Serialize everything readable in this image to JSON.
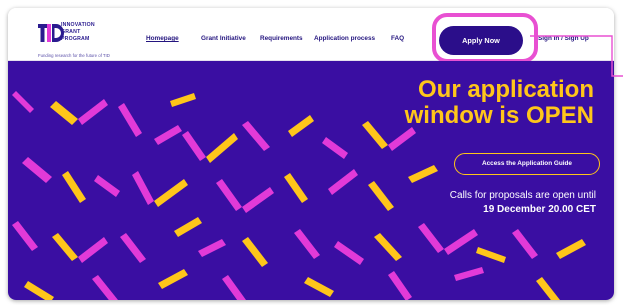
{
  "brand": {
    "logo_letters": "TID",
    "name_line_1": "INNOVATION",
    "name_line_2": "GRANT",
    "name_line_3": "PROGRAM",
    "tagline": "Funding research for the future of TID"
  },
  "nav": {
    "homepage": "Homepage",
    "grant_initiative": "Grant Initiative",
    "requirements": "Requirements",
    "application_process": "Application process",
    "faq": "FAQ",
    "apply": "Apply Now",
    "sign_in": "Sign In / Sign Up"
  },
  "hero": {
    "title_line_1": "Our application",
    "title_line_2": "window is OPEN",
    "guide_button": "Access the Application Guide",
    "calls_text": "Calls for proposals are open until",
    "deadline": "19 December 20.00 CET"
  },
  "colors": {
    "hero_background": "#3a0ea2",
    "accent_yellow": "#ffc61a",
    "accent_magenta": "#e23ad8",
    "nav_text": "#24157f",
    "highlight": "#e850d2"
  }
}
